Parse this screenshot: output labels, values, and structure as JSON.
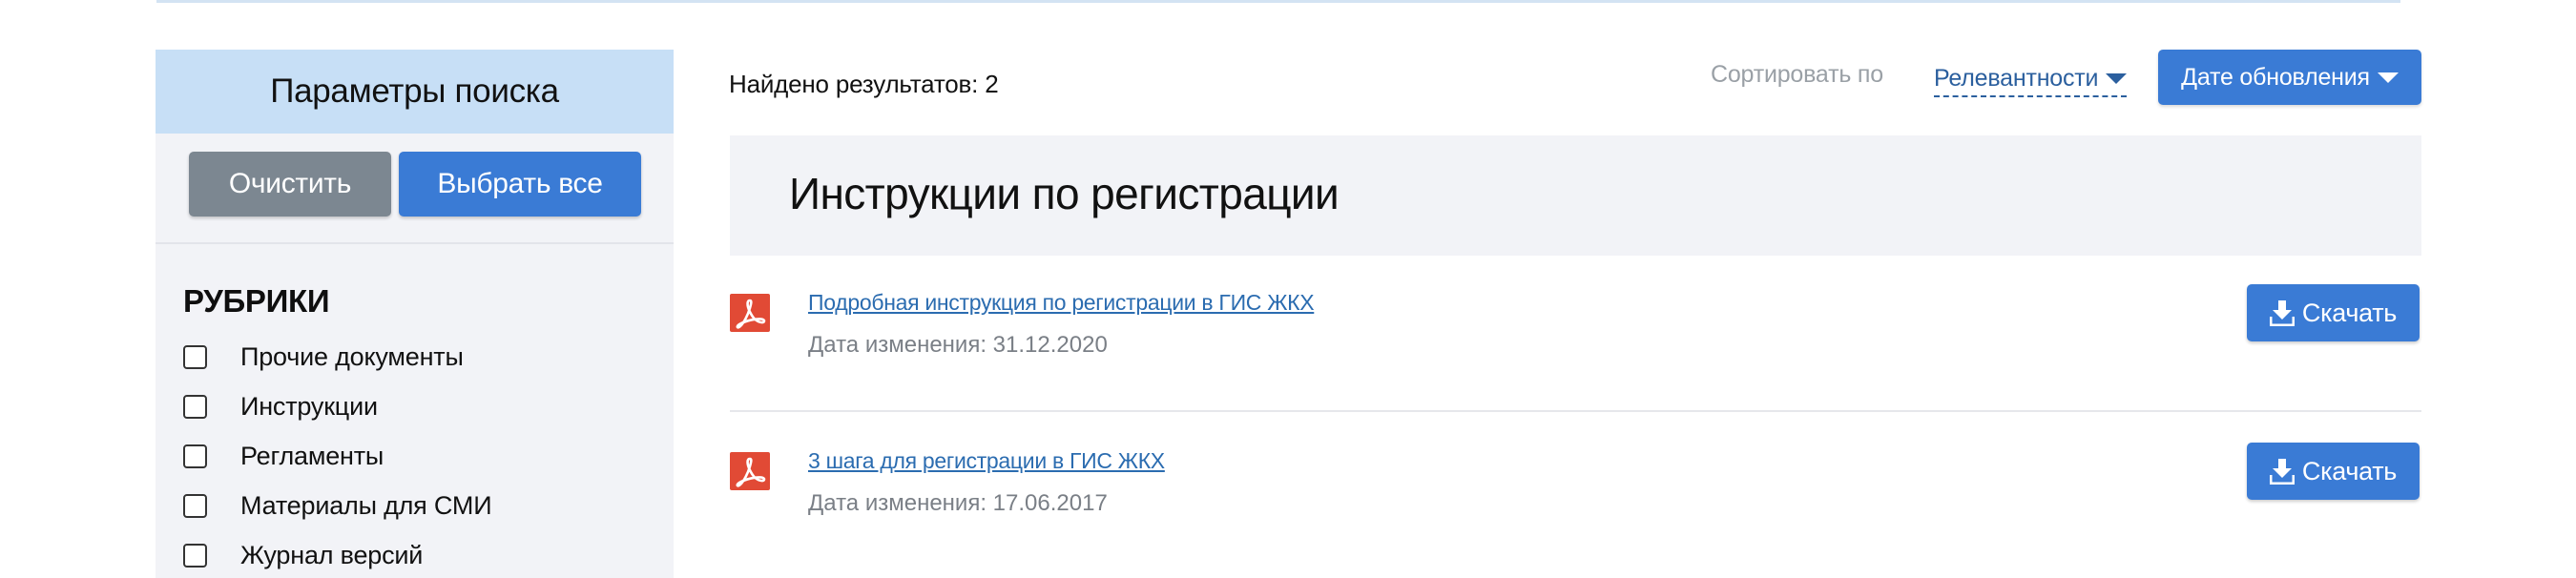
{
  "sidebar": {
    "title": "Параметры поиска",
    "clear_label": "Очистить",
    "select_all_label": "Выбрать все",
    "rubrics_title": "РУБРИКИ",
    "rubrics": [
      {
        "label": "Прочие документы",
        "checked": false
      },
      {
        "label": "Инструкции",
        "checked": false
      },
      {
        "label": "Регламенты",
        "checked": false
      },
      {
        "label": "Материалы для СМИ",
        "checked": false
      },
      {
        "label": "Журнал версий",
        "checked": false
      }
    ]
  },
  "results": {
    "found_label": "Найдено результатов:",
    "found_count": "2"
  },
  "sort": {
    "label": "Сортировать по",
    "relevance_label": "Релевантности",
    "date_label": "Дате обновления",
    "icon": "caret-down-icon"
  },
  "section": {
    "title": "Инструкции по регистрации"
  },
  "documents": [
    {
      "title": "Подробная инструкция по регистрации в ГИС ЖКХ",
      "date_label": "Дата изменения:",
      "date": "31.12.2020",
      "download_label": "Скачать",
      "icon": "pdf-icon"
    },
    {
      "title": "3 шага для регистрации в ГИС ЖКХ",
      "date_label": "Дата изменения:",
      "date": "17.06.2017",
      "download_label": "Скачать",
      "icon": "pdf-icon"
    }
  ],
  "colors": {
    "accent": "#3a7bd5",
    "sidebar_header": "#c7dff6",
    "panel_bg": "#f2f3f7",
    "pdf_red": "#e14a35",
    "link": "#2b6cb0",
    "muted": "#9aa0a6"
  }
}
